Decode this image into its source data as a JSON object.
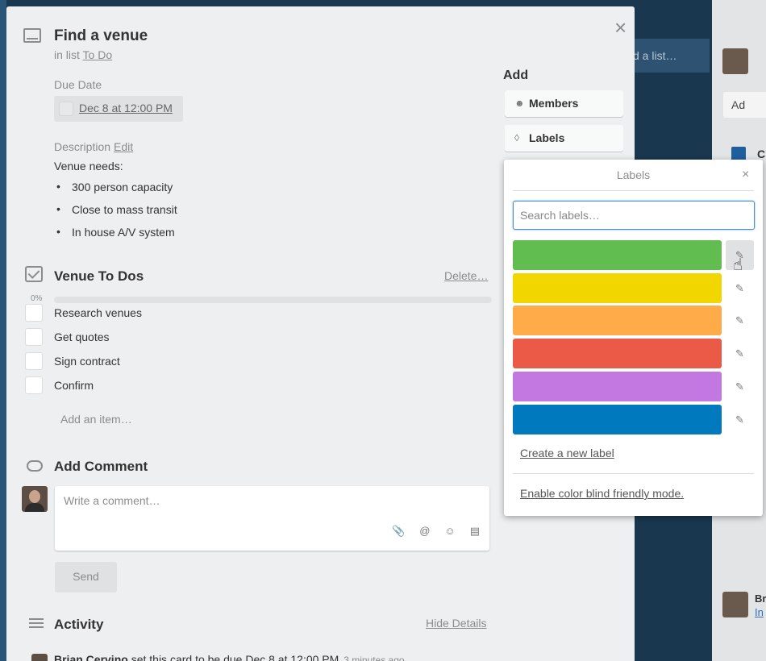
{
  "background": {
    "add_list_text": "d a list…",
    "right_add_label": "Ad",
    "right_card_letter": "C",
    "right_activity_name": "Br",
    "right_activity_link": "In"
  },
  "card": {
    "title": "Find a venue",
    "in_list_prefix": "in list",
    "list_name": "To Do",
    "close_glyph": "×"
  },
  "due": {
    "label": "Due Date",
    "value": "Dec 8 at 12:00 PM"
  },
  "description": {
    "label": "Description",
    "edit_label": "Edit",
    "intro": "Venue needs:",
    "items": [
      "300 person capacity",
      "Close to mass transit",
      "In house A/V system"
    ]
  },
  "checklist": {
    "title": "Venue To Dos",
    "delete_label": "Delete…",
    "percent": "0%",
    "progress": 0,
    "items": [
      "Research venues",
      "Get quotes",
      "Sign contract",
      "Confirm"
    ],
    "add_item_label": "Add an item…"
  },
  "comment": {
    "title": "Add Comment",
    "placeholder": "Write a comment…",
    "send_label": "Send"
  },
  "activity": {
    "title": "Activity",
    "hide_label": "Hide Details",
    "entry_user": "Brian Cervino",
    "entry_text": "set this card to be due Dec 8 at 12:00 PM",
    "entry_time": "3 minutes ago"
  },
  "sidebar": {
    "heading": "Add",
    "members_label": "Members",
    "labels_label": "Labels"
  },
  "labels_popover": {
    "title": "Labels",
    "close_glyph": "×",
    "search_placeholder": "Search labels…",
    "colors": [
      "#61bd4f",
      "#f2d600",
      "#ffab4a",
      "#eb5a46",
      "#c377e0",
      "#0079bf"
    ],
    "create_label": "Create a new label",
    "color_blind_label": "Enable color blind friendly mode."
  }
}
